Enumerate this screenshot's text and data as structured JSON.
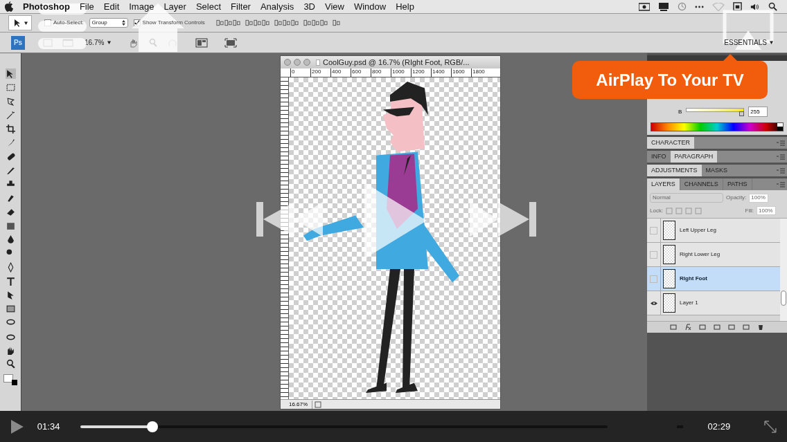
{
  "menu_bar": {
    "app_name": "Photoshop",
    "items": [
      "File",
      "Edit",
      "Image",
      "Layer",
      "Select",
      "Filter",
      "Analysis",
      "3D",
      "View",
      "Window",
      "Help"
    ]
  },
  "options_bar": {
    "auto_select": {
      "label": "Auto-Select:",
      "checked": false
    },
    "target": "Group",
    "show_transform": {
      "label": "Show Transform Controls",
      "checked": true
    }
  },
  "app_bar": {
    "logo": "Ps",
    "zoom": "16.7%",
    "workspace": "ESSENTIALS"
  },
  "document": {
    "title": "CoolGuy.psd @ 16.7% (RIght Foot, RGB/...",
    "ruler_labels": [
      "0",
      "200",
      "400",
      "600",
      "800",
      "1000",
      "1200",
      "1400",
      "1600",
      "1800"
    ],
    "zoom": "16.67%"
  },
  "color_panel": {
    "channel": "B",
    "value": "255",
    "level": 1.0
  },
  "panel_groups": [
    {
      "tabs": [
        {
          "label": "CHARACTER",
          "selected": true
        }
      ]
    },
    {
      "tabs": [
        {
          "label": "INFO",
          "selected": false
        },
        {
          "label": "PARAGRAPH",
          "selected": true
        }
      ]
    },
    {
      "tabs": [
        {
          "label": "ADJUSTMENTS",
          "selected": true
        },
        {
          "label": "MASKS",
          "selected": false
        }
      ]
    }
  ],
  "layers_panel": {
    "tabs": [
      {
        "label": "LAYERS",
        "selected": true
      },
      {
        "label": "CHANNELS",
        "selected": false
      },
      {
        "label": "PATHS",
        "selected": false
      }
    ],
    "blend_mode": "Normal",
    "opacity_label": "Opacity:",
    "opacity": "100%",
    "lock_label": "Lock:",
    "fill_label": "Fill:",
    "fill": "100%",
    "disabled": true,
    "layers": [
      {
        "name": "Left Upper Leg",
        "visible": false,
        "selected": false
      },
      {
        "name": "Right Lower Leg",
        "visible": false,
        "selected": false
      },
      {
        "name": "RIght Foot",
        "visible": false,
        "selected": true
      },
      {
        "name": "Layer 1",
        "visible": true,
        "selected": false
      }
    ]
  },
  "airplay_callout": "AirPlay To Your TV",
  "player": {
    "current_time": "01:34",
    "total_time": "02:29",
    "level": 0.13
  }
}
